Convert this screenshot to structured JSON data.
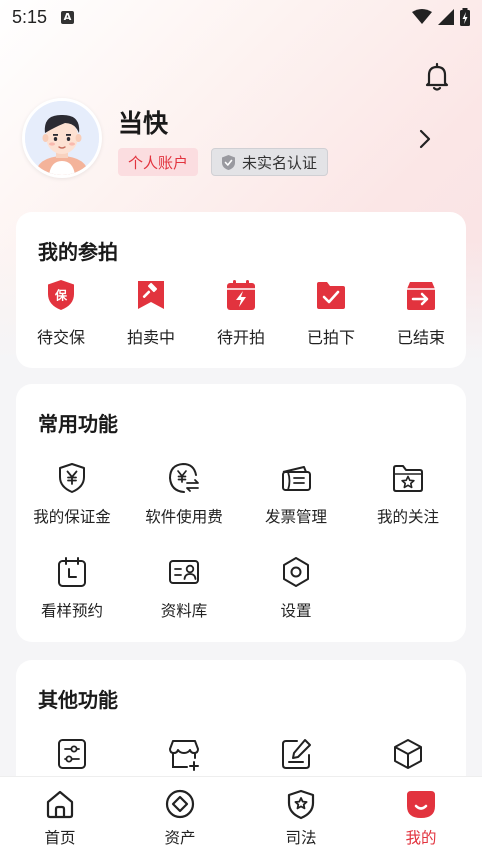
{
  "status_bar": {
    "time": "5:15",
    "notification_icon": "A"
  },
  "colors": {
    "accent": "#e2333e",
    "text": "#1a1a1a",
    "background": "#f5f5f7"
  },
  "profile": {
    "name": "当快",
    "account_tag": "个人账户",
    "verify_tag": "未实名认证"
  },
  "my_bidding": {
    "title": "我的参拍",
    "items": [
      {
        "label": "待交保",
        "icon": "shield-bao-icon"
      },
      {
        "label": "拍卖中",
        "icon": "gavel-bookmark-icon"
      },
      {
        "label": "待开拍",
        "icon": "calendar-flash-icon"
      },
      {
        "label": "已拍下",
        "icon": "folder-check-icon"
      },
      {
        "label": "已结束",
        "icon": "box-arrow-icon"
      }
    ]
  },
  "common_functions": {
    "title": "常用功能",
    "items": [
      {
        "label": "我的保证金",
        "icon": "shield-yen-icon"
      },
      {
        "label": "软件使用费",
        "icon": "yen-exchange-icon"
      },
      {
        "label": "发票管理",
        "icon": "invoice-icon"
      },
      {
        "label": "我的关注",
        "icon": "folder-star-icon"
      },
      {
        "label": "看样预约",
        "icon": "calendar-clock-icon"
      },
      {
        "label": "资料库",
        "icon": "id-card-icon"
      },
      {
        "label": "设置",
        "icon": "settings-icon"
      }
    ]
  },
  "other_functions": {
    "title": "其他功能",
    "items": [
      {
        "label": "",
        "icon": "sliders-icon"
      },
      {
        "label": "",
        "icon": "store-add-icon"
      },
      {
        "label": "",
        "icon": "document-edit-icon"
      },
      {
        "label": "",
        "icon": "cube-icon"
      }
    ]
  },
  "bottom_nav": {
    "items": [
      {
        "label": "首页",
        "icon": "home-icon"
      },
      {
        "label": "资产",
        "icon": "asset-icon"
      },
      {
        "label": "司法",
        "icon": "justice-icon"
      },
      {
        "label": "我的",
        "icon": "profile-icon",
        "active": true
      }
    ]
  }
}
